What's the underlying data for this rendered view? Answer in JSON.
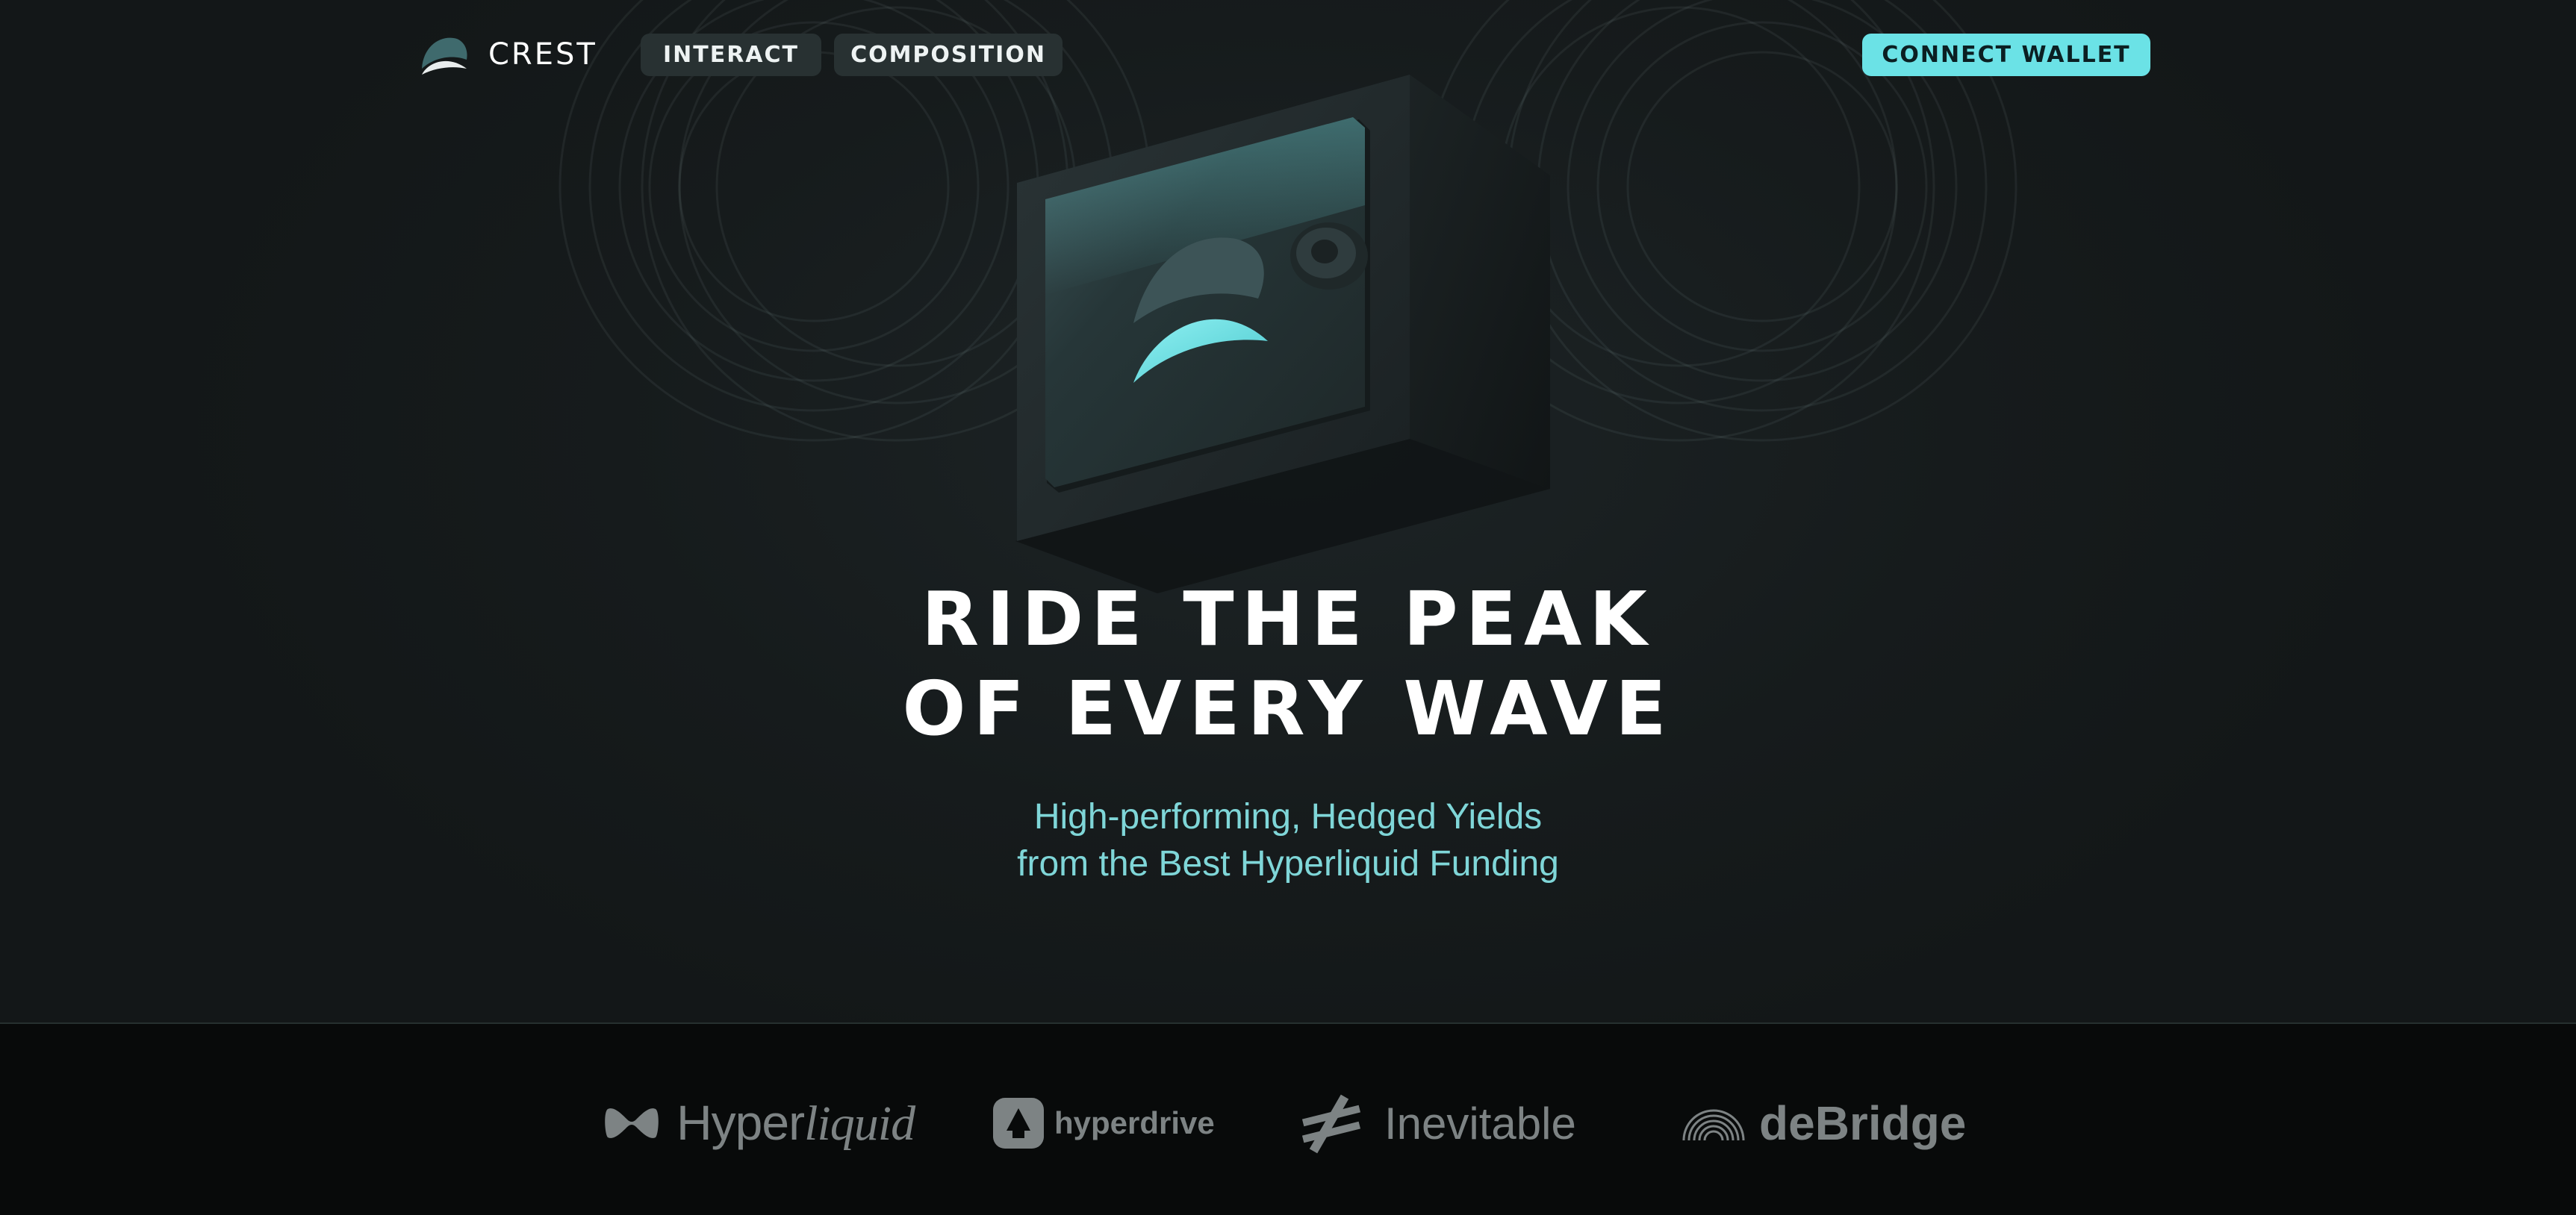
{
  "brand": {
    "name": "CREST",
    "logo_icon": "crest-wave-icon"
  },
  "nav": {
    "items": [
      {
        "label": "INTERACT"
      },
      {
        "label": "COMPOSITION"
      }
    ],
    "connect_label": "CONNECT WALLET"
  },
  "hero": {
    "headline_line1": "RIDE THE PEAK",
    "headline_line2": "OF EVERY WAVE",
    "subtitle_line1": "High-performing, Hedged Yields",
    "subtitle_line2": "from the Best Hyperliquid Funding"
  },
  "partners": {
    "hyperliquid": {
      "prefix": "Hyper",
      "suffix": "liquid"
    },
    "hyperdrive": "hyperdrive",
    "inevitable": "Inevitable",
    "debridge": "deBridge"
  },
  "colors": {
    "accent": "#6be2e6",
    "subtitle": "#7fd6d8",
    "background": "#171c1d",
    "partner_bar": "#080a0a"
  }
}
